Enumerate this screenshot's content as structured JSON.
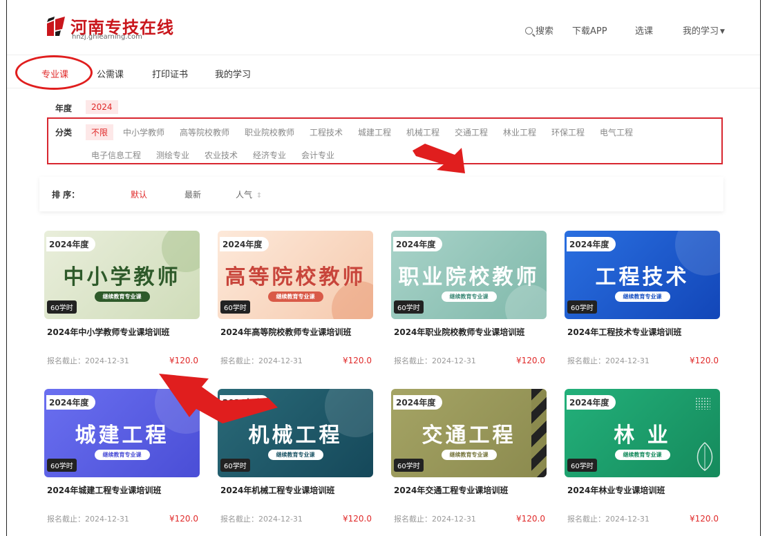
{
  "brand": {
    "name": "河南专技在线",
    "url": "hnzj.ghlearning.com"
  },
  "top_nav": {
    "search": "搜索",
    "download": "下载APP",
    "choose": "选课",
    "my_learning": "我的学习"
  },
  "tabs": [
    "专业课",
    "公需课",
    "打印证书",
    "我的学习"
  ],
  "year": {
    "label": "年度",
    "value": "2024"
  },
  "category": {
    "label": "分类",
    "row1": [
      "不限",
      "中小学教师",
      "高等院校教师",
      "职业院校教师",
      "工程技术",
      "城建工程",
      "机械工程",
      "交通工程",
      "林业工程",
      "环保工程",
      "电气工程"
    ],
    "row2": [
      "电子信息工程",
      "测绘专业",
      "农业技术",
      "经济专业",
      "会计专业"
    ]
  },
  "sort": {
    "label": "排 序：",
    "options": [
      "默认",
      "最新",
      "人气"
    ],
    "sort_icon": "sort-updown-icon"
  },
  "courses": [
    {
      "year": "2024年度",
      "big": "中小学教师",
      "sub": "继续教育专业课",
      "hours": "60学时",
      "title": "2024年中小学教师专业课培训班",
      "deadline": "报名截止：2024-12-31",
      "price": "¥120.0"
    },
    {
      "year": "2024年度",
      "big": "高等院校教师",
      "sub": "继续教育专业课",
      "hours": "60学时",
      "title": "2024年高等院校教师专业课培训班",
      "deadline": "报名截止：2024-12-31",
      "price": "¥120.0"
    },
    {
      "year": "2024年度",
      "big": "职业院校教师",
      "sub": "继续教育专业课",
      "hours": "60学时",
      "title": "2024年职业院校教师专业课培训班",
      "deadline": "报名截止：2024-12-31",
      "price": "¥120.0"
    },
    {
      "year": "2024年度",
      "big": "工程技术",
      "sub": "继续教育专业课",
      "hours": "60学时",
      "title": "2024年工程技术专业课培训班",
      "deadline": "报名截止：2024-12-31",
      "price": "¥120.0"
    },
    {
      "year": "2024年度",
      "big": "城建工程",
      "sub": "继续教育专业课",
      "hours": "60学时",
      "title": "2024年城建工程专业课培训班",
      "deadline": "报名截止：2024-12-31",
      "price": "¥120.0"
    },
    {
      "year": "2024年度",
      "big": "机械工程",
      "sub": "继续教育专业课",
      "hours": "60学时",
      "title": "2024年机械工程专业课培训班",
      "deadline": "报名截止：2024-12-31",
      "price": "¥120.0"
    },
    {
      "year": "2024年度",
      "big": "交通工程",
      "sub": "继续教育专业课",
      "hours": "60学时",
      "title": "2024年交通工程专业课培训班",
      "deadline": "报名截止：2024-12-31",
      "price": "¥120.0"
    },
    {
      "year": "2024年度",
      "big": "林 业",
      "sub": "继续教育专业课",
      "hours": "60学时",
      "title": "2024年林业专业课培训班",
      "deadline": "报名截止：2024-12-31",
      "price": "¥120.0"
    }
  ],
  "colors": {
    "accent": "#e02a2a",
    "annotation": "#d8262f"
  }
}
